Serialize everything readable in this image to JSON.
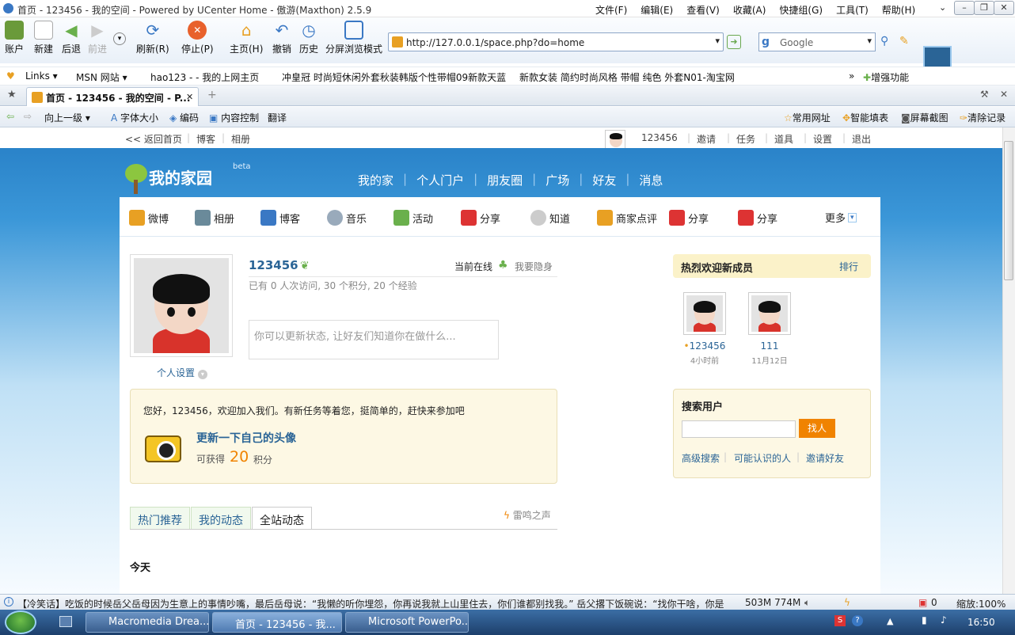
{
  "window": {
    "title": "首页 - 123456 - 我的空间 - Powered by UCenter Home - 傲游(Maxthon) 2.5.9",
    "menu": [
      "文件(F)",
      "编辑(E)",
      "查看(V)",
      "收藏(A)",
      "快捷组(G)",
      "工具(T)",
      "帮助(H)"
    ]
  },
  "toolbar": {
    "buttons": [
      "账户",
      "新建",
      "后退",
      "前进",
      "刷新(R)",
      "停止(P)",
      "主页(H)",
      "撤销",
      "历史",
      "分屏浏览模式"
    ],
    "address": "http://127.0.0.1/space.php?do=home",
    "search_placeholder": "Google"
  },
  "bookmarks": [
    "Links",
    "MSN 网站",
    "hao123 - - 我的上网主页",
    "冲皇冠 时尚短休闲外套秋装韩版个性带帽09新款天蓝",
    "新款女装 简约时尚风格 带帽 纯色 外套N01-淘宝网"
  ],
  "bookmarks_right": "增强功能",
  "tab": {
    "label": "首页 - 123456 - 我的空间 - P..."
  },
  "navbar": {
    "left": [
      "向上一级",
      "字体大小",
      "编码",
      "内容控制",
      "翻译"
    ],
    "right": [
      "常用网址",
      "智能填表",
      "屏幕截图",
      "清除记录"
    ]
  },
  "page": {
    "top_left": [
      "<< 返回首页",
      "博客",
      "相册"
    ],
    "top_right": [
      "123456",
      "邀请",
      "任务",
      "道具",
      "设置",
      "退出"
    ],
    "logo": "我的家园",
    "logo_beta": "beta",
    "main_nav": [
      "我的家",
      "个人门户",
      "朋友圈",
      "广场",
      "好友",
      "消息"
    ],
    "sub_nav": [
      "微博",
      "相册",
      "博客",
      "音乐",
      "活动",
      "分享",
      "知道",
      "商家点评",
      "分享",
      "分享",
      "更多"
    ],
    "profile": {
      "username": "123456",
      "online": "当前在线",
      "hide": "我要隐身",
      "stats": "已有 0 人次访问, 30 个积分, 20 个经验",
      "status_placeholder": "你可以更新状态, 让好友们知道你在做什么...",
      "settings": "个人设置"
    },
    "welcome": {
      "text": "您好，123456，欢迎加入我们。有新任务等着您，挺简单的，赶快来参加吧",
      "task": "更新一下自己的头像",
      "earn": "可获得",
      "points": "20",
      "unit": "积分"
    },
    "feed_tabs": [
      "热门推荐",
      "我的动态",
      "全站动态"
    ],
    "feed_link": "雷鸣之声",
    "today": "今天",
    "new_members": {
      "title": "热烈欢迎新成员",
      "rank": "排行",
      "members": [
        {
          "name": "123456",
          "time": "4小时前"
        },
        {
          "name": "111",
          "time": "11月12日"
        }
      ]
    },
    "search_user": {
      "title": "搜索用户",
      "button": "找人",
      "links": [
        "高级搜索",
        "可能认识的人",
        "邀请好友"
      ]
    }
  },
  "statusbar": {
    "news": "【冷笑话】吃饭的时候岳父岳母因为生意上的事情吵嘴，最后岳母说：“我懒的听你埋怨，你再说我就上山里住去，你们谁都别找我。” 岳父撂下饭碗说：“找你干啥，你是",
    "memory": "503M 774M",
    "zoom": "缩放:100%"
  },
  "taskbar": {
    "tasks": [
      "Macromedia Drea...",
      "首页 - 123456 - 我...",
      "Microsoft PowerPo..."
    ],
    "clock": "16:50"
  }
}
